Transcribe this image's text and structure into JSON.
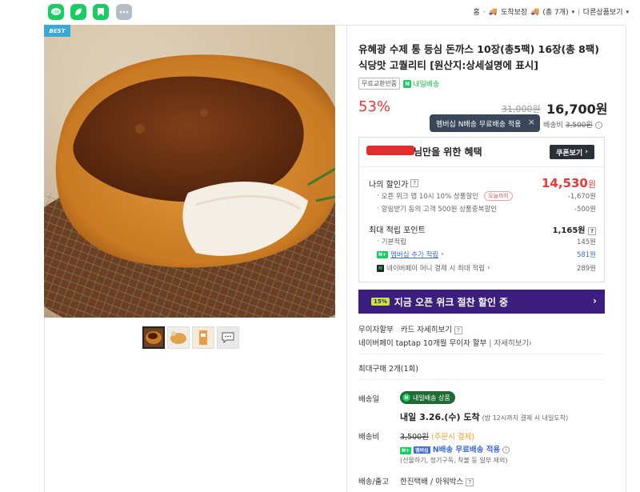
{
  "share_buttons": [
    {
      "name": "line-share",
      "color": "#19ce60"
    },
    {
      "name": "band-share",
      "color": "#19ce60"
    },
    {
      "name": "bookmark-share",
      "color": "#19ce60"
    },
    {
      "name": "more-share",
      "color": "#b4bcc6"
    }
  ],
  "breadcrumb": {
    "home": "홈",
    "arrival": "도착보장",
    "count": "(총 7개)",
    "other": "다른상품보기"
  },
  "product": {
    "badge": "BEST",
    "title": "유혜광 수제 통 등심 돈까스 10장(총5팩) 16장(총 8팩) 식당맛 고퀄리티 [원산지:상세설명에 표시]",
    "tag_free": "무료교환반품",
    "tag_tomorrow": "내일배송",
    "discount_pct": "53%",
    "original_price": "31,000원",
    "sale_price": "16,700원",
    "tooltip": "멤버십 N배송 무료배송 적용",
    "shipping_fee_label": "배송비",
    "shipping_fee": "3,500원"
  },
  "benefit": {
    "header": "님만을 위한 혜택",
    "coupon_button": "쿠폰보기",
    "my_discount_label": "나의 할인가",
    "my_discount_price": "14,530",
    "my_discount_unit": "원",
    "sub1_label": "오픈 위크 앱 10시 10% 상품할인",
    "sub1_tag": "오늘까지",
    "sub1_value": "-1,670원",
    "sub2_label": "알림받기 동의 고객 500원 상품중복할인",
    "sub2_value": "-500원",
    "points_label": "최대 적립 포인트",
    "points_value": "1,165원",
    "basic_label": "기본적립",
    "basic_value": "145원",
    "membership_label": "멤버십 추가 적립",
    "membership_value": "581원",
    "npay_label": "네이버페이 머니 결제 시 최대 적립",
    "npay_value": "289원"
  },
  "banner": {
    "badge": "15%",
    "text": "지금 오픈 위크 절찬 할인 중",
    "color": "#3b1e7d"
  },
  "installment": {
    "label": "무이자할부",
    "card": "카드 자세히보기",
    "naverpay": "네이버페이 taptap 10개월 무이자 할부",
    "detail": "자세히보기"
  },
  "max_purchase": "최대구매 2개(1회)",
  "delivery": {
    "label": "배송일",
    "tag": "내일배송 상품",
    "date_main": "내일 3.26.(수) 도착",
    "date_note": "(밤 12시까지 결제 시 내일도착)"
  },
  "shipping": {
    "label": "배송비",
    "fee": "3,500원",
    "fee_note": "(주문시 결제)",
    "membership_badge": "멤버십",
    "n_free": "N배송 무료배송 적용",
    "exclusion": "(선물하기, 정기구독, 착불 등 일부 제외)"
  },
  "courier": {
    "label": "배송/출고",
    "value": "한진택배 / 아워박스"
  }
}
